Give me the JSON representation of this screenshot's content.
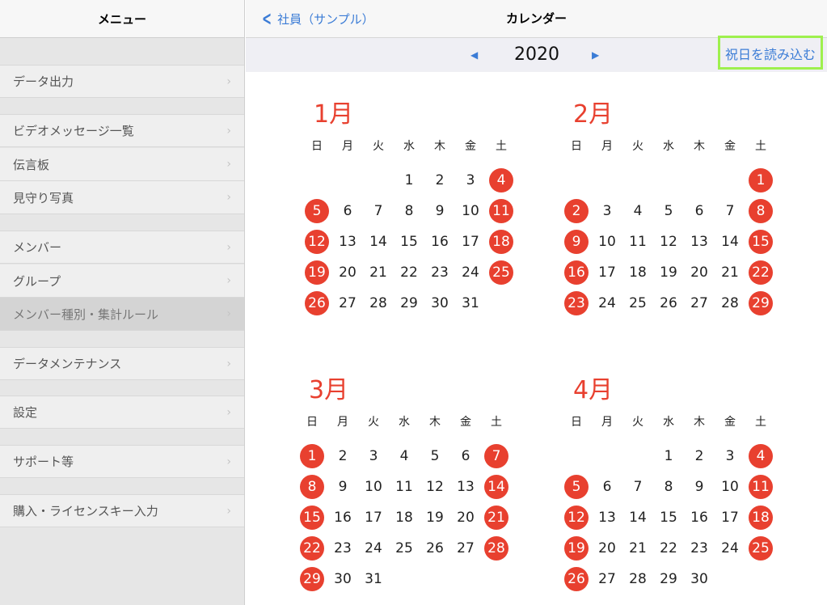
{
  "sidebar": {
    "title": "メニュー",
    "items": [
      {
        "label": "データ出力"
      },
      {
        "label": "ビデオメッセージ一覧"
      },
      {
        "label": "伝言板"
      },
      {
        "label": "見守り写真"
      },
      {
        "label": "メンバー"
      },
      {
        "label": "グループ"
      },
      {
        "label": "メンバー種別・集計ルール"
      },
      {
        "label": "データメンテナンス"
      },
      {
        "label": "設定"
      },
      {
        "label": "サポート等"
      },
      {
        "label": "購入・ライセンスキー入力"
      }
    ],
    "chevron_icon": "chevron-right-icon"
  },
  "header": {
    "back_label": "社員（サンプル）",
    "title": "カレンダー"
  },
  "yearbar": {
    "prev_icon": "◀",
    "next_icon": "▶",
    "year": "2020",
    "load_holidays_label": "祝日を読み込む"
  },
  "weekdays": [
    "日",
    "月",
    "火",
    "水",
    "木",
    "金",
    "土"
  ],
  "colors": {
    "accent_blue": "#3b7cd6",
    "holiday_red": "#e8402f",
    "highlight_green": "#9ef04e"
  },
  "months": [
    {
      "title": "1月",
      "first_weekday": 3,
      "days": 31,
      "holidays": [
        4,
        5,
        11,
        12,
        18,
        19,
        25,
        26
      ]
    },
    {
      "title": "2月",
      "first_weekday": 6,
      "days": 29,
      "holidays": [
        1,
        2,
        8,
        9,
        15,
        16,
        22,
        23,
        29
      ]
    },
    {
      "title": "3月",
      "first_weekday": 0,
      "days": 31,
      "holidays": [
        1,
        7,
        8,
        14,
        15,
        21,
        22,
        28,
        29
      ]
    },
    {
      "title": "4月",
      "first_weekday": 3,
      "days": 30,
      "holidays": [
        4,
        5,
        11,
        12,
        18,
        19,
        25,
        26
      ]
    }
  ]
}
